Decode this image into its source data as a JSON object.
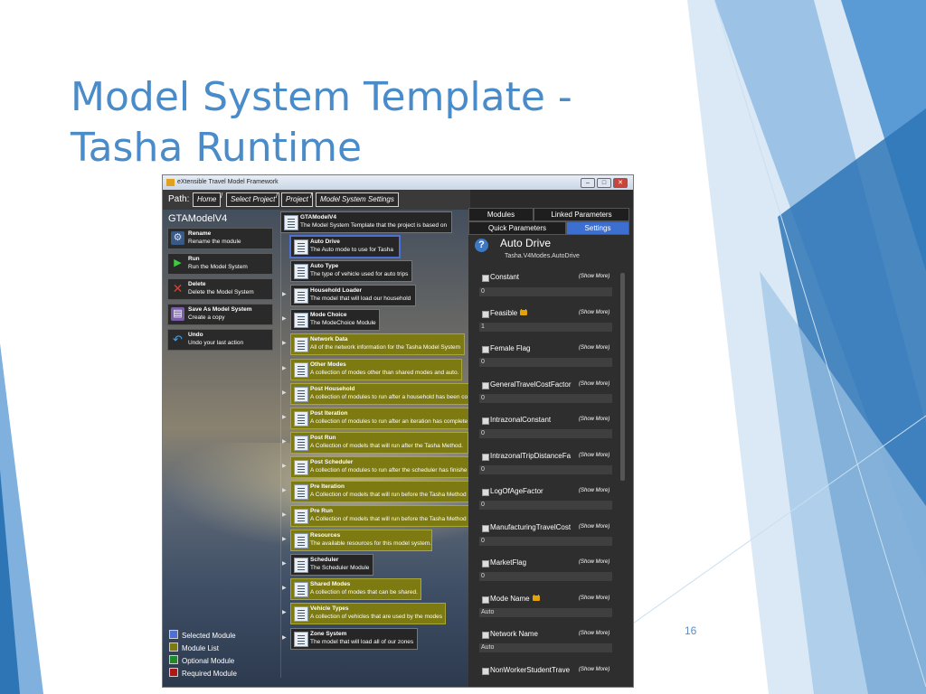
{
  "slide": {
    "title_line1": "Model System Template -",
    "title_line2": "Tasha Runtime",
    "page_number": "16",
    "accent_color": "#4a8bc9"
  },
  "window": {
    "title": "eXtensible Travel Model Framework",
    "buttons": [
      "–",
      "□",
      "✕"
    ]
  },
  "path": {
    "label": "Path:",
    "crumbs": [
      "Home",
      "Select Project",
      "Project",
      "Model System Settings"
    ],
    "separator": "/"
  },
  "model": {
    "name": "GTAModelV4"
  },
  "commands": [
    {
      "title": "Rename",
      "desc": "Rename the module",
      "icon": "gears-icon"
    },
    {
      "title": "Run",
      "desc": "Run the Model System",
      "icon": "play-icon"
    },
    {
      "title": "Delete",
      "desc": "Delete the Model System",
      "icon": "delete-icon"
    },
    {
      "title": "Save As Model System",
      "desc": "Create a copy",
      "icon": "save-icon"
    },
    {
      "title": "Undo",
      "desc": "Undo your last action",
      "icon": "undo-icon"
    }
  ],
  "root_module": {
    "title": "GTAModelV4",
    "desc": "The Model System Template that the project is based on"
  },
  "modules": [
    {
      "title": "Auto Drive",
      "desc": "The Auto mode to use for Tasha",
      "kind": "selected"
    },
    {
      "title": "Auto Type",
      "desc": "The type of vehicle used for auto trips",
      "kind": "module"
    },
    {
      "title": "Household Loader",
      "desc": "The model that will load our household",
      "kind": "module"
    },
    {
      "title": "Mode Choice",
      "desc": "The ModeChoice Module",
      "kind": "module"
    },
    {
      "title": "Network Data",
      "desc": "All of the network information for the Tasha Model System",
      "kind": "list"
    },
    {
      "title": "Other Modes",
      "desc": "A collection of modes other than shared modes and auto.",
      "kind": "list"
    },
    {
      "title": "Post Household",
      "desc": "A collection of modules to run after a household has been co",
      "kind": "list"
    },
    {
      "title": "Post Iteration",
      "desc": "A collection of modules to run after an iteration has complete",
      "kind": "list"
    },
    {
      "title": "Post Run",
      "desc": "A Collection of models that will run after the Tasha Method.",
      "kind": "list"
    },
    {
      "title": "Post Scheduler",
      "desc": "A collection of modules to run after the scheduler has finishe",
      "kind": "list"
    },
    {
      "title": "Pre Iteration",
      "desc": "A Collection of models that will run before the Tasha Method",
      "kind": "list"
    },
    {
      "title": "Pre Run",
      "desc": "A Collection of models that will run before the Tasha Method",
      "kind": "list"
    },
    {
      "title": "Resources",
      "desc": "The available resources for this model system.",
      "kind": "list"
    },
    {
      "title": "Scheduler",
      "desc": "The Scheduler Module",
      "kind": "module"
    },
    {
      "title": "Shared Modes",
      "desc": "A collection of modes that can be shared.",
      "kind": "list"
    },
    {
      "title": "Vehicle Types",
      "desc": "A collection of vehicles that are used by the modes",
      "kind": "list"
    },
    {
      "title": "Zone System",
      "desc": "The model that will load all of our zones",
      "kind": "module"
    }
  ],
  "legend": [
    {
      "label": "Selected Module",
      "color": "#4e6fd3"
    },
    {
      "label": "Module List",
      "color": "#7d7a12"
    },
    {
      "label": "Optional Module",
      "color": "#1e8a2a"
    },
    {
      "label": "Required Module",
      "color": "#b01818"
    }
  ],
  "panel": {
    "tabs": [
      "Modules",
      "Linked Parameters",
      "Quick Parameters",
      "Settings"
    ],
    "active_tab": "Settings",
    "module_title": "Auto Drive",
    "module_type": "Tasha.V4Modes.AutoDrive",
    "show_more_label": "(Show More)",
    "parameters": [
      {
        "name": "Constant",
        "value": "0",
        "locked": false
      },
      {
        "name": "Feasible",
        "value": "1",
        "locked": true
      },
      {
        "name": "Female Flag",
        "value": "0",
        "locked": false
      },
      {
        "name": "GeneralTravelCostFactor",
        "value": "0",
        "locked": false
      },
      {
        "name": "IntrazonalConstant",
        "value": "0",
        "locked": false
      },
      {
        "name": "IntrazonalTripDistanceFa",
        "value": "0",
        "locked": false
      },
      {
        "name": "LogOfAgeFactor",
        "value": "0",
        "locked": false
      },
      {
        "name": "ManufacturingTravelCost",
        "value": "0",
        "locked": false
      },
      {
        "name": "MarketFlag",
        "value": "0",
        "locked": false
      },
      {
        "name": "Mode Name",
        "value": "Auto",
        "locked": true
      },
      {
        "name": "Network Name",
        "value": "Auto",
        "locked": false
      },
      {
        "name": "NonWorkerStudentTrave",
        "value": "",
        "locked": false
      }
    ]
  }
}
